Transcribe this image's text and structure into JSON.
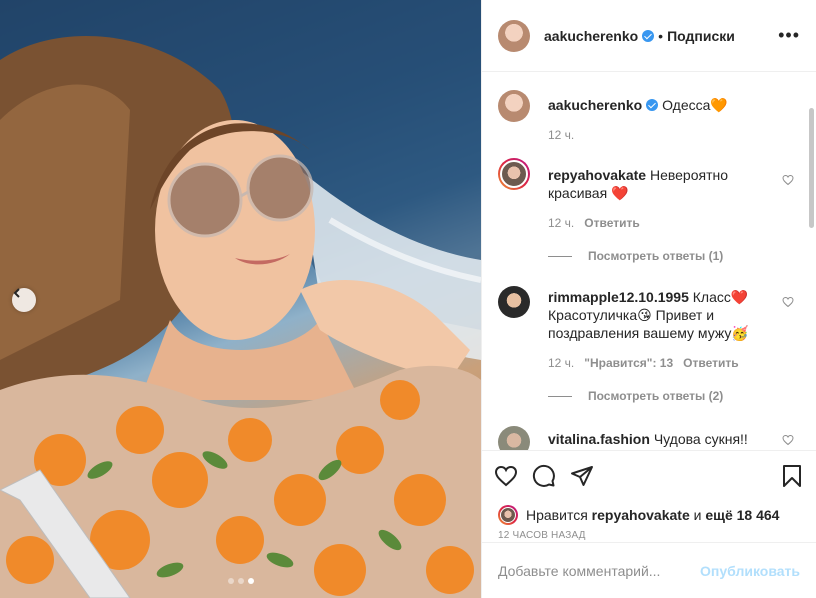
{
  "header": {
    "username": "aakucherenko",
    "separator": "•",
    "follow_label": "Подписки",
    "more_icon": "more-horizontal-icon",
    "more_label": "•••"
  },
  "caption": {
    "username": "aakucherenko",
    "text": "Одесса",
    "emoji": "🧡",
    "time": "12 ч."
  },
  "comments": [
    {
      "username": "repyahovakate",
      "text": "Невероятно красивая",
      "emoji": "❤️",
      "time": "12 ч.",
      "reply_label": "Ответить",
      "view_replies": "Посмотреть ответы (1)"
    },
    {
      "username": "rimmapple12.10.1995",
      "text_a": "Класс",
      "emoji_a": "❤️",
      "text_b": "Красотуличка",
      "emoji_b": "😘",
      "text_c": "Привет и поздравления вашему мужу",
      "emoji_c": "🥳",
      "time": "12 ч.",
      "likes": "\"Нравится\": 13",
      "reply_label": "Ответить",
      "view_replies": "Посмотреть ответы (2)"
    },
    {
      "username": "vitalina.fashion",
      "text": "Чудова сукня!!"
    }
  ],
  "actions": {
    "like_icon": "heart-icon",
    "comment_icon": "comment-icon",
    "share_icon": "share-icon",
    "save_icon": "bookmark-icon"
  },
  "likes": {
    "prefix": "Нравится",
    "user": "repyahovakate",
    "middle": "и",
    "others": "ещё 18 464"
  },
  "posted_ago": "12 ЧАСОВ НАЗАД",
  "add_comment": {
    "placeholder": "Добавьте комментарий...",
    "publish_label": "Опубликовать"
  },
  "carousel": {
    "prev_icon": "chevron-left-icon",
    "slides": 3,
    "active_slide": 3
  },
  "colors": {
    "verified": "#3897f0",
    "heart": "#ed4956",
    "publish_disabled": "#b2dffc",
    "muted": "#8e8e8e"
  }
}
